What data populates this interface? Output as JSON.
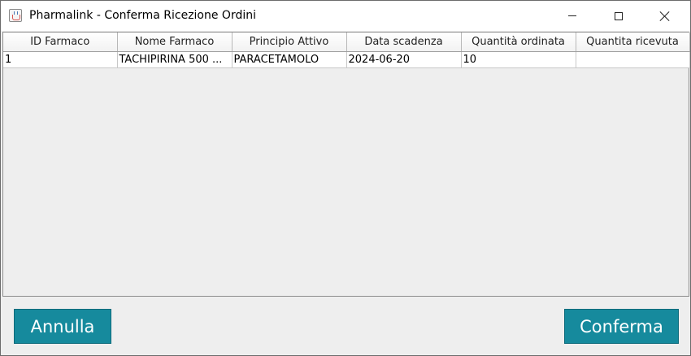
{
  "window": {
    "title": "Pharmalink - Conferma Ricezione Ordini",
    "icon": "java-cup-icon"
  },
  "table": {
    "columns": [
      "ID Farmaco",
      "Nome Farmaco",
      "Principio Attivo",
      "Data scadenza",
      "Quantità ordinata",
      "Quantita ricevuta"
    ],
    "rows": [
      [
        "1",
        "TACHIPIRINA 500 ...",
        "PARACETAMOLO",
        "2024-06-20",
        "10",
        ""
      ]
    ]
  },
  "buttons": {
    "cancel_label": "Annulla",
    "confirm_label": "Conferma"
  },
  "colors": {
    "button_bg": "#168a9d",
    "panel_bg": "#eeeeee"
  }
}
